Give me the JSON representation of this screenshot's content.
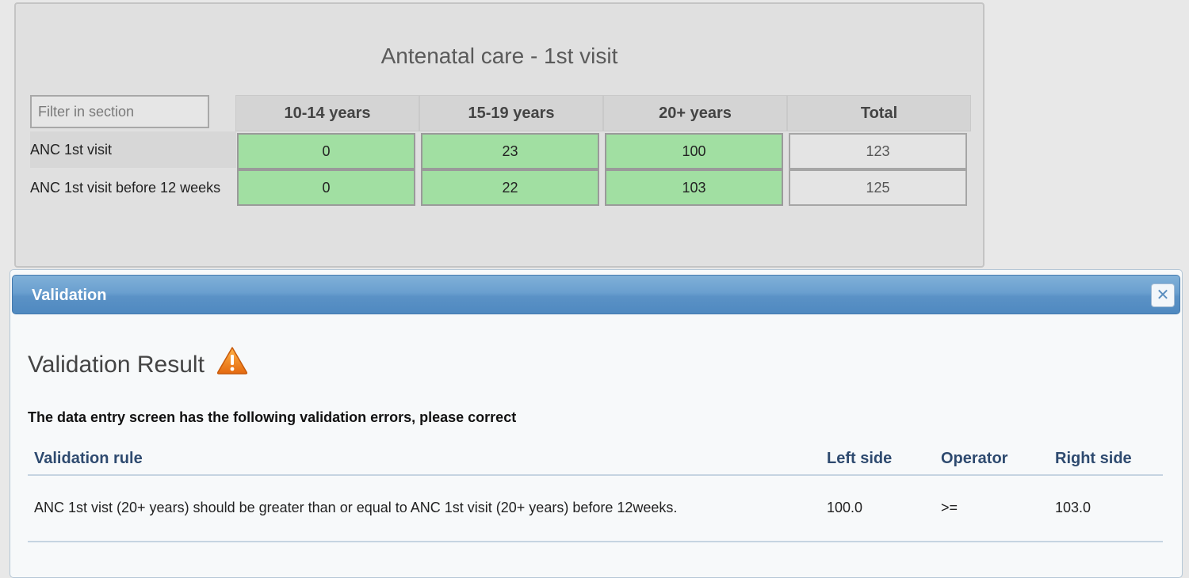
{
  "section": {
    "title": "Antenatal care - 1st visit",
    "filter_placeholder": "Filter in section",
    "columns": [
      "10-14 years",
      "15-19 years",
      "20+ years",
      "Total"
    ],
    "rows": [
      {
        "label": "ANC 1st visit",
        "values": [
          "0",
          "23",
          "100"
        ],
        "total": "123"
      },
      {
        "label": "ANC 1st visit before 12 weeks",
        "values": [
          "0",
          "22",
          "103"
        ],
        "total": "125"
      }
    ]
  },
  "dialog": {
    "title": "Validation",
    "close_icon": "close-icon",
    "heading": "Validation Result",
    "warning_icon": "warning-icon",
    "instruction": "The data entry screen has the following validation errors, please correct",
    "table": {
      "headers": [
        "Validation rule",
        "Left side",
        "Operator",
        "Right side"
      ],
      "rows": [
        {
          "rule": "ANC 1st vist (20+ years) should be greater than or equal to ANC 1st visit (20+ years) before 12weeks.",
          "left": "100.0",
          "operator": ">=",
          "right": "103.0"
        }
      ]
    }
  },
  "colors": {
    "valid_cell": "#a1dfa2",
    "titlebar": "#5b92c6",
    "header_text": "#2e4a6f",
    "warning": "#f08c1e"
  }
}
